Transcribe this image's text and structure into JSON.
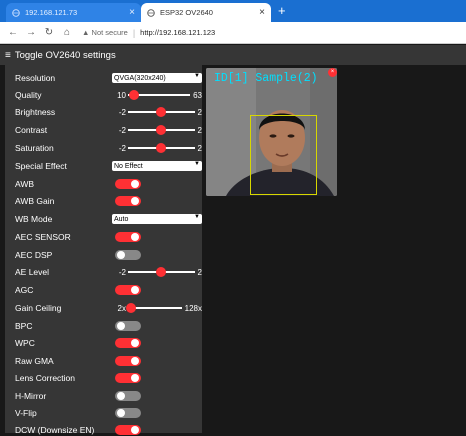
{
  "tabs": [
    {
      "title": "192.168.121.73",
      "active": false
    },
    {
      "title": "ESP32 OV2640",
      "active": true
    }
  ],
  "address": {
    "security": "Not secure",
    "url": "http://192.168.121.123"
  },
  "header": {
    "title": "Toggle OV2640 settings"
  },
  "settings": {
    "resolution": {
      "label": "Resolution",
      "value": "QVGA(320x240)"
    },
    "quality": {
      "label": "Quality",
      "min": "10",
      "max": "63",
      "fraction": 0.1
    },
    "brightness": {
      "label": "Brightness",
      "min": "-2",
      "max": "2",
      "fraction": 0.5
    },
    "contrast": {
      "label": "Contrast",
      "min": "-2",
      "max": "2",
      "fraction": 0.5
    },
    "saturation": {
      "label": "Saturation",
      "min": "-2",
      "max": "2",
      "fraction": 0.5
    },
    "special_effect": {
      "label": "Special Effect",
      "value": "No Effect"
    },
    "awb": {
      "label": "AWB",
      "on": true
    },
    "awb_gain": {
      "label": "AWB Gain",
      "on": true
    },
    "wb_mode": {
      "label": "WB Mode",
      "value": "Auto"
    },
    "aec_sensor": {
      "label": "AEC SENSOR",
      "on": true
    },
    "aec_dsp": {
      "label": "AEC DSP",
      "on": false
    },
    "ae_level": {
      "label": "AE Level",
      "min": "-2",
      "max": "2",
      "fraction": 0.5
    },
    "agc": {
      "label": "AGC",
      "on": true
    },
    "gain_ceiling": {
      "label": "Gain Ceiling",
      "min": "2x",
      "max": "128x",
      "fraction": 0.05
    },
    "bpc": {
      "label": "BPC",
      "on": false
    },
    "wpc": {
      "label": "WPC",
      "on": true
    },
    "raw_gma": {
      "label": "Raw GMA",
      "on": true
    },
    "lens_correction": {
      "label": "Lens Correction",
      "on": true
    },
    "h_mirror": {
      "label": "H-Mirror",
      "on": false
    },
    "v_flip": {
      "label": "V-Flip",
      "on": false
    },
    "dcw": {
      "label": "DCW (Downsize EN)",
      "on": true
    }
  },
  "stream": {
    "overlay": "ID[1] Sample(2)"
  },
  "colors": {
    "accent": "#ff3034",
    "panel": "#363636",
    "background": "#181818",
    "tabbar": "#1a6fd1",
    "overlay_text": "#00e0ff"
  }
}
